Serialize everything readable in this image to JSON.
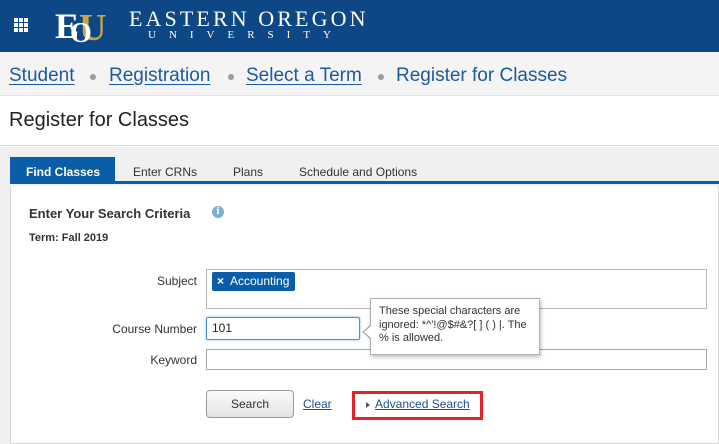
{
  "header": {
    "university_name": "EASTERN OREGON",
    "university_sub": "UNIVERSITY",
    "brand_color": "#0e4785",
    "apps_icon": "grid-icon"
  },
  "breadcrumb": {
    "items": [
      "Student",
      "Registration",
      "Select a Term",
      "Register for Classes"
    ]
  },
  "page": {
    "title": "Register for Classes"
  },
  "tabs": [
    {
      "label": "Find Classes",
      "active": true
    },
    {
      "label": "Enter CRNs",
      "active": false
    },
    {
      "label": "Plans",
      "active": false
    },
    {
      "label": "Schedule and Options",
      "active": false
    }
  ],
  "search": {
    "section_title": "Enter Your Search Criteria",
    "term": "Term: Fall 2019",
    "subject_label": "Subject",
    "subject_chip": "Accounting",
    "chip_remove": "×",
    "course_label": "Course Number",
    "course_value": "101",
    "keyword_label": "Keyword",
    "keyword_value": "",
    "tooltip": "These special characters are ignored: *^'!@$#&?[ ] ( ) |. The % is allowed.",
    "search_button": "Search",
    "clear_link": "Clear",
    "advanced_link": "Advanced Search",
    "highlight_color": "#e4222a"
  }
}
